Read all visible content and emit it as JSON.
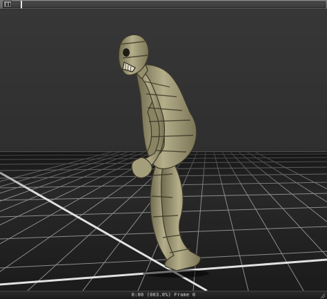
{
  "toolbar": {
    "pause_icon": "pause-icon"
  },
  "viewport": {
    "model": "bandaged mummy figure",
    "floor": "grid"
  },
  "status": {
    "playback_text": "0:00 (003.0%) Frame 0"
  },
  "colors": {
    "background": "#2f2f2f",
    "grid_line": "#9a9a9a",
    "model_skin": "#a39c78"
  }
}
